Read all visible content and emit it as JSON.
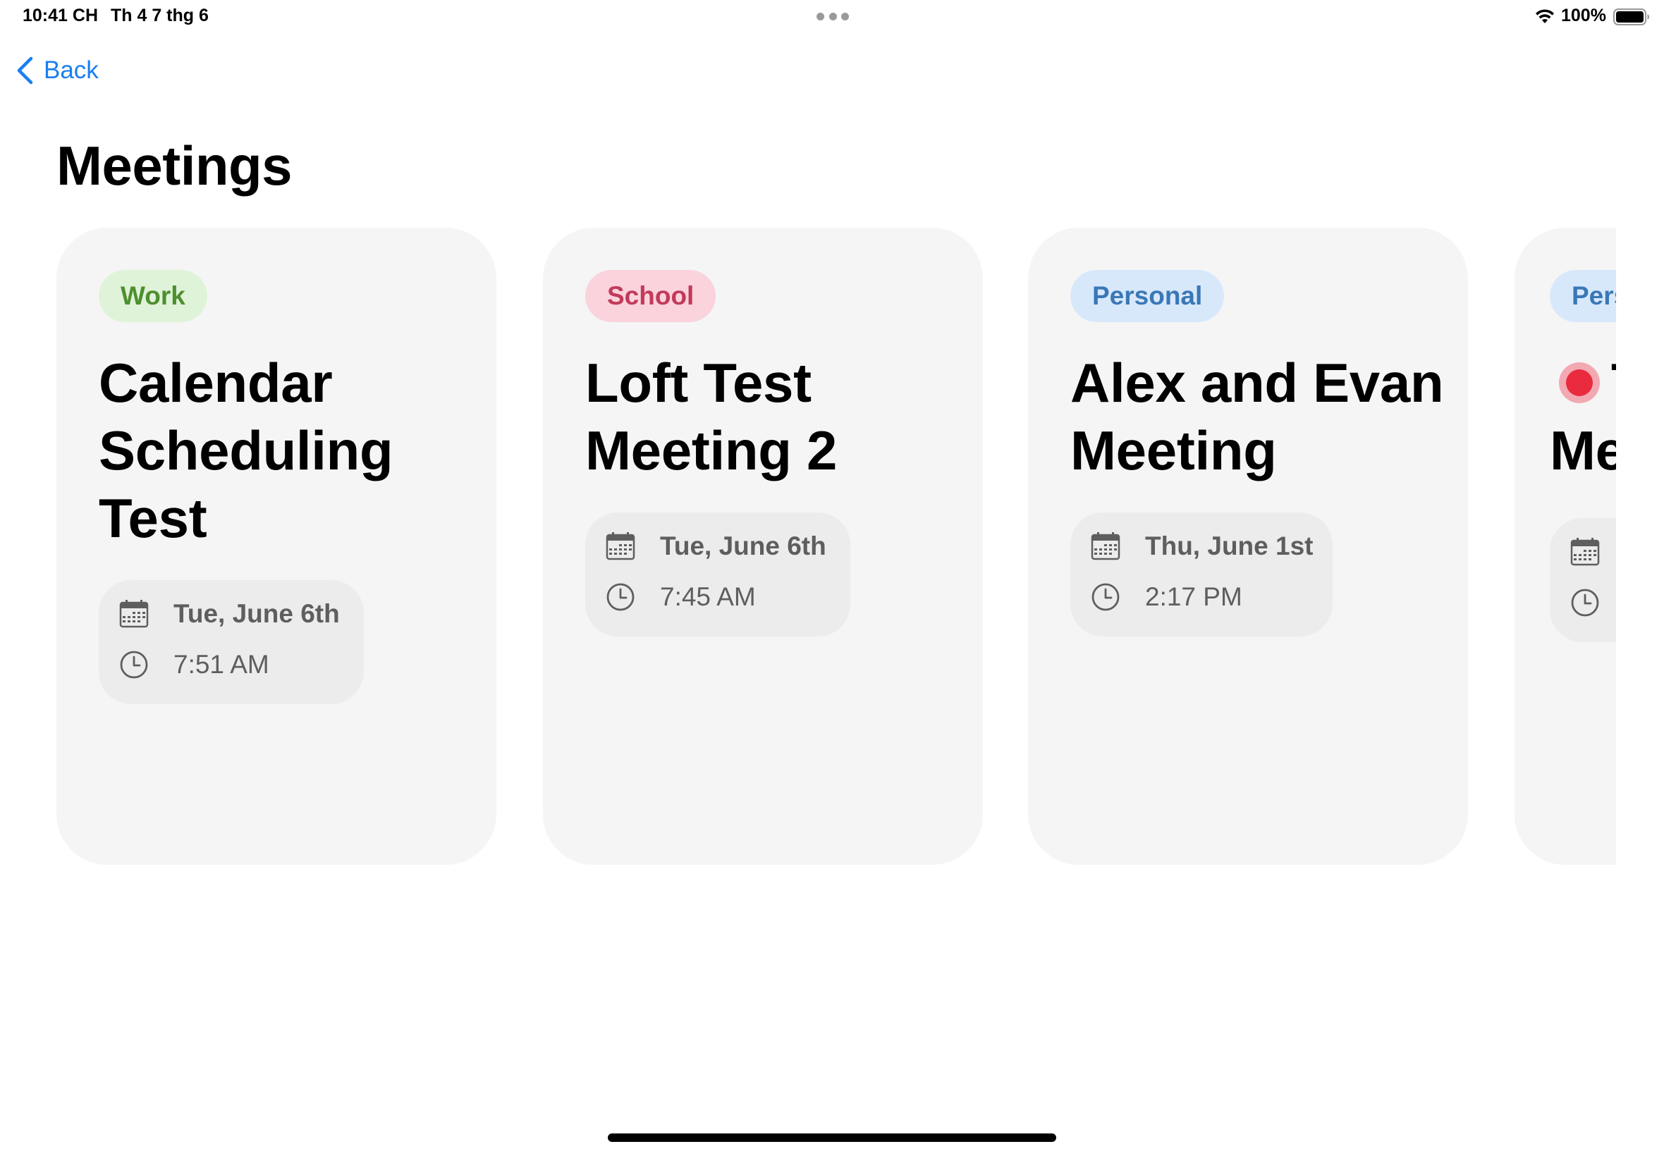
{
  "status_bar": {
    "time": "10:41 CH",
    "date": "Th 4 7 thg 6",
    "battery": "100%"
  },
  "nav": {
    "back_label": "Back"
  },
  "page": {
    "title": "Meetings"
  },
  "meetings": [
    {
      "tag": "Work",
      "tag_color": "#4e8f2f",
      "tag_bg": "#dff3d9",
      "title": "Calendar Scheduling Test",
      "date": "Tue, June 6th",
      "time": "7:51 AM",
      "icons": [
        "calendar-icon",
        "clock-icon"
      ]
    },
    {
      "tag": "School",
      "tag_color": "#c23a5a",
      "tag_bg": "#fad3dc",
      "title": "Loft Test Meeting 2",
      "date": "Tue, June 6th",
      "time": "7:45 AM",
      "icons": [
        "calendar-icon",
        "clock-icon"
      ]
    },
    {
      "tag": "Personal",
      "tag_color": "#3a78b5",
      "tag_bg": "#d8e8fb",
      "title": "Alex and Evan Meeting",
      "date": "Thu, June 1st",
      "time": "2:17 PM",
      "icons": [
        "calendar-icon",
        "clock-icon"
      ]
    },
    {
      "tag": "Pers",
      "tag_color": "#3a78b5",
      "tag_bg": "#d8e8fb",
      "title_line1": "T",
      "title_line2": "Me",
      "live_indicator_color": "#ea2b3e",
      "icons": [
        "calendar-icon",
        "clock-icon"
      ]
    }
  ],
  "colors": {
    "accent": "#1a7ff0",
    "card_bg": "#f5f5f5",
    "info_bg": "#ececec",
    "info_text": "#5e5e5e"
  }
}
